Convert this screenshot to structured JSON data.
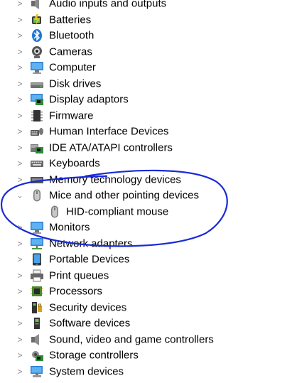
{
  "tree": {
    "audio": "Audio inputs and outputs",
    "batteries": "Batteries",
    "bluetooth": "Bluetooth",
    "cameras": "Cameras",
    "computer": "Computer",
    "disk": "Disk drives",
    "display": "Display adaptors",
    "firmware": "Firmware",
    "hid": "Human Interface Devices",
    "ide": "IDE ATA/ATAPI controllers",
    "keyboards": "Keyboards",
    "memory": "Memory technology devices",
    "mice": "Mice and other pointing devices",
    "mouse_child": "HID-compliant mouse",
    "monitors": "Monitors",
    "network": "Network adapters",
    "portable": "Portable Devices",
    "print": "Print queues",
    "processors": "Processors",
    "security": "Security devices",
    "software": "Software devices",
    "sound": "Sound, video and game controllers",
    "storage": "Storage controllers",
    "system": "System devices"
  },
  "colors": {
    "annotation_ink": "#1a2ad6",
    "chevron": "#8a8a8a"
  },
  "icons": [
    "speaker-icon",
    "battery-icon",
    "bluetooth-icon",
    "webcam-icon",
    "monitor-icon",
    "disk-icon",
    "display-adapter-icon",
    "chip-icon",
    "hid-icon",
    "ide-controller-icon",
    "keyboard-icon",
    "memory-card-icon",
    "mouse-icon",
    "monitor-icon",
    "network-icon",
    "portable-device-icon",
    "printer-icon",
    "processor-icon",
    "security-key-icon",
    "software-device-icon",
    "sound-icon",
    "storage-controller-icon",
    "system-device-icon"
  ]
}
